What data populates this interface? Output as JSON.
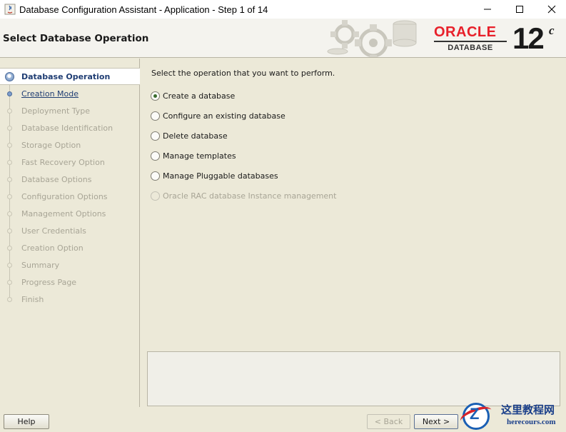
{
  "window": {
    "title": "Database Configuration Assistant - Application - Step 1 of 14",
    "controls": [
      "minimize-icon",
      "maximize-icon",
      "close-icon"
    ]
  },
  "header": {
    "page_title": "Select Database Operation",
    "brand": "ORACLE",
    "brand_sub": "DATABASE",
    "version": "12",
    "version_suffix": "c",
    "brand_color": "#e8202a"
  },
  "nav": {
    "items": [
      {
        "label": "Database Operation",
        "state": "active"
      },
      {
        "label": "Creation Mode",
        "state": "link"
      },
      {
        "label": "Deployment Type",
        "state": "disabled"
      },
      {
        "label": "Database Identification",
        "state": "disabled"
      },
      {
        "label": "Storage Option",
        "state": "disabled"
      },
      {
        "label": "Fast Recovery Option",
        "state": "disabled"
      },
      {
        "label": "Database Options",
        "state": "disabled"
      },
      {
        "label": "Configuration Options",
        "state": "disabled"
      },
      {
        "label": "Management Options",
        "state": "disabled"
      },
      {
        "label": "User Credentials",
        "state": "disabled"
      },
      {
        "label": "Creation Option",
        "state": "disabled"
      },
      {
        "label": "Summary",
        "state": "disabled"
      },
      {
        "label": "Progress Page",
        "state": "disabled"
      },
      {
        "label": "Finish",
        "state": "disabled"
      }
    ]
  },
  "main": {
    "prompt": "Select the operation that you want to perform.",
    "options": [
      {
        "label": "Create a database",
        "selected": true,
        "enabled": true
      },
      {
        "label": "Configure an existing database",
        "selected": false,
        "enabled": true
      },
      {
        "label": "Delete database",
        "selected": false,
        "enabled": true
      },
      {
        "label": "Manage templates",
        "selected": false,
        "enabled": true
      },
      {
        "label": "Manage Pluggable databases",
        "selected": false,
        "enabled": true
      },
      {
        "label": "Oracle RAC database Instance management",
        "selected": false,
        "enabled": false
      }
    ]
  },
  "footer": {
    "help_label": "Help",
    "back_label": "< Back",
    "next_label": "Next >"
  },
  "watermark": {
    "letter": "Z",
    "text": "这里教程网",
    "domain": "herecours.com"
  }
}
